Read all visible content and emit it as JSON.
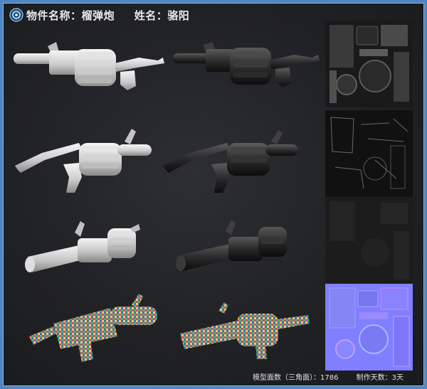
{
  "header": {
    "item_label": "物件名称：",
    "item_name": "榴弹炮",
    "author_label": "姓名：",
    "author_name": "骆阳"
  },
  "footer": {
    "face_count_label": "模型面数（三角面）：",
    "face_count": "1786",
    "days_label": "制作天数：",
    "days": "3天"
  },
  "colors": {
    "frame_blue": "#4f86bf",
    "background": "#1f2023",
    "normal_map": "#7f7fff"
  },
  "icons": [
    "logo-icon"
  ]
}
